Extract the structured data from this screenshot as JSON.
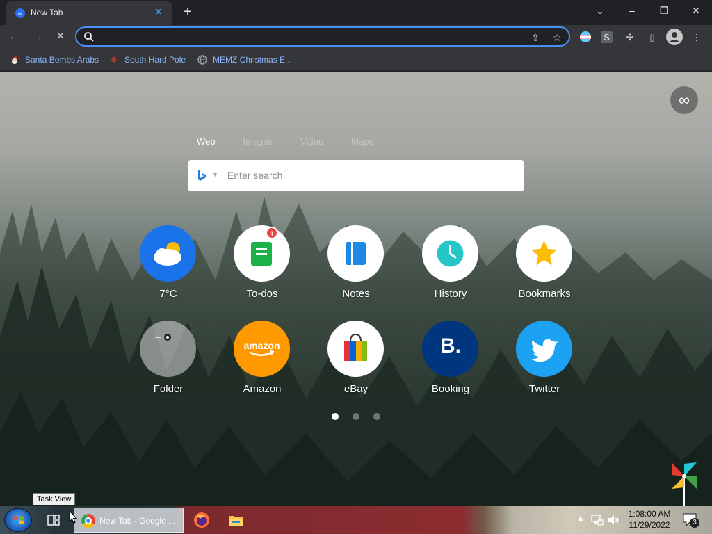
{
  "browser": {
    "tab_title": "New Tab",
    "tab_close": "✕",
    "new_tab": "+",
    "omnibox_value": "",
    "window_controls": {
      "tab_search": "⌄",
      "minimize": "–",
      "restore": "❐",
      "close": "✕"
    }
  },
  "toolbar": {
    "back": "←",
    "forward": "→",
    "reload": "✕",
    "share": "⇪",
    "star": "☆",
    "ext_s_label": "S",
    "puzzle": "✣",
    "sidepanel": "▯",
    "menu": "⋮"
  },
  "bookmarks": [
    {
      "label": "Santa Bombs Arabs",
      "icon": "santa-icon"
    },
    {
      "label": "South Hard Pole",
      "icon": "snowflake-icon"
    },
    {
      "label": "MEMZ Christmas E...",
      "icon": "globe-icon"
    }
  ],
  "newtab": {
    "search_tabs": [
      "Web",
      "Images",
      "Video",
      "Maps"
    ],
    "search_placeholder": "Enter search",
    "infinity": "∞",
    "tiles": [
      {
        "label": "7°C",
        "icon": "weather-icon"
      },
      {
        "label": "To-dos",
        "icon": "todos-icon",
        "badge": "1"
      },
      {
        "label": "Notes",
        "icon": "notes-icon"
      },
      {
        "label": "History",
        "icon": "history-icon"
      },
      {
        "label": "Bookmarks",
        "icon": "star-icon"
      },
      {
        "label": "Folder",
        "icon": "folder-icon"
      },
      {
        "label": "Amazon",
        "icon": "amazon-icon",
        "logo_text": "amazon"
      },
      {
        "label": "eBay",
        "icon": "ebay-bag-icon"
      },
      {
        "label": "Booking",
        "icon": "booking-icon",
        "logo_text": "B."
      },
      {
        "label": "Twitter",
        "icon": "twitter-bird-icon"
      }
    ],
    "pages": 3,
    "active_page": 1
  },
  "tooltip": "Task View",
  "taskbar": {
    "chrome_label": "New Tab - Google ...",
    "clock_time": "1:08:00 AM",
    "clock_date": "11/29/2022",
    "notification_count": "3"
  }
}
